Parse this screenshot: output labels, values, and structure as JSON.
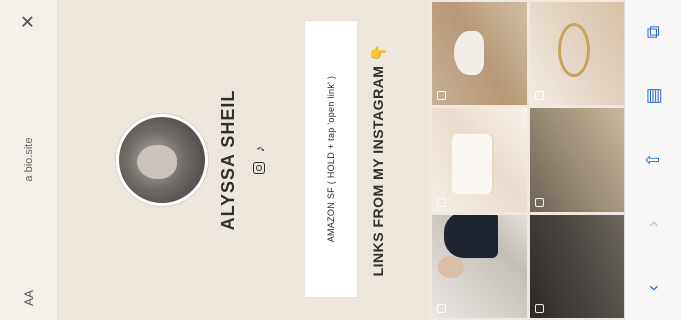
{
  "browser": {
    "text_size_label": "AA",
    "url": "a bio.site",
    "close_glyph": "✕"
  },
  "profile": {
    "name": "ALYSSA SHEIL",
    "social_icons": [
      "instagram-icon",
      "tiktok-icon"
    ],
    "tiktok_glyph": "♪"
  },
  "links": {
    "amazon_label": "AMAZON SF ( HOLD + tap 'open link' )",
    "instagram_heading": "LINKS FROM MY INSTAGRAM",
    "heading_emoji": "👇"
  },
  "grid": {
    "tiles": [
      {
        "icon": "gallery-icon"
      },
      {
        "icon": "gallery-icon"
      },
      {
        "icon": "gallery-icon"
      },
      {
        "icon": "gallery-icon"
      },
      {
        "icon": "gallery-icon"
      },
      {
        "icon": "gallery-icon"
      }
    ]
  },
  "toolbar": {
    "back_glyph": "‹",
    "forward_glyph": "›",
    "share_glyph": "⇧",
    "bookmarks_glyph": "▤",
    "tabs_glyph": "⧉",
    "colors": {
      "active": "#2f6fd6",
      "disabled": "#a9c4ef"
    }
  }
}
